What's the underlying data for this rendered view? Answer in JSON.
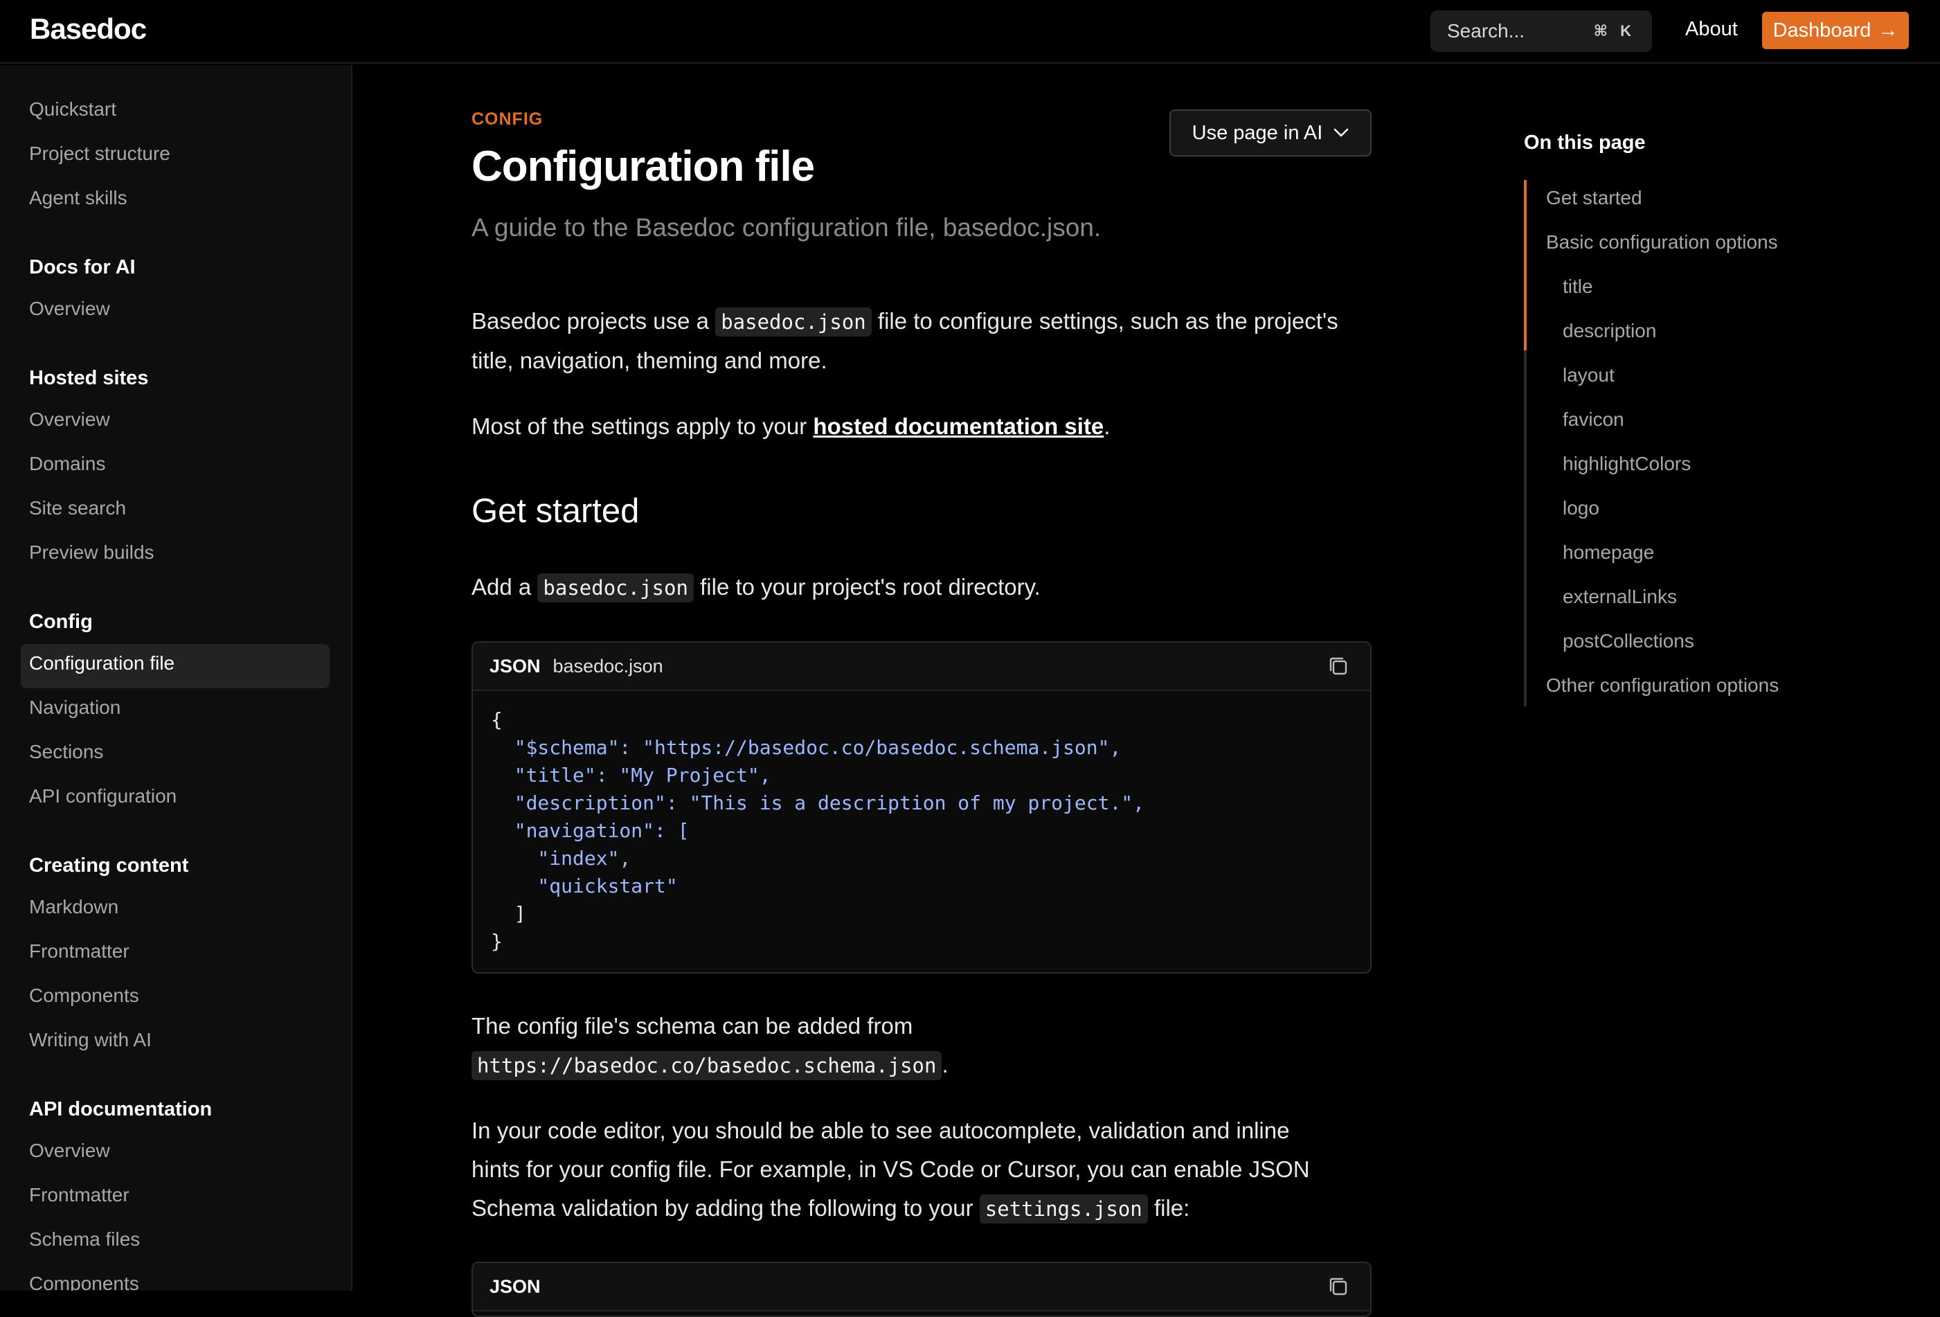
{
  "header": {
    "logo": "Basedoc",
    "search_placeholder": "Search...",
    "search_shortcut": "⌘ K",
    "about": "About",
    "dashboard": "Dashboard",
    "dashboard_arrow": "→"
  },
  "sidebar": {
    "top_items": [
      "Quickstart",
      "Project structure",
      "Agent skills"
    ],
    "sections": [
      {
        "heading": "Docs for AI",
        "items": [
          "Overview"
        ]
      },
      {
        "heading": "Hosted sites",
        "items": [
          "Overview",
          "Domains",
          "Site search",
          "Preview builds"
        ]
      },
      {
        "heading": "Config",
        "items": [
          "Configuration file",
          "Navigation",
          "Sections",
          "API configuration"
        ]
      },
      {
        "heading": "Creating content",
        "items": [
          "Markdown",
          "Frontmatter",
          "Components",
          "Writing with AI"
        ]
      },
      {
        "heading": "API documentation",
        "items": [
          "Overview",
          "Frontmatter",
          "Schema files",
          "Components"
        ]
      }
    ],
    "active_item": "Configuration file"
  },
  "main": {
    "eyebrow": "CONFIG",
    "title": "Configuration file",
    "subtitle": "A guide to the Basedoc configuration file, basedoc.json.",
    "use_ai_button": "Use page in AI",
    "p1_pre": "Basedoc projects use a ",
    "p1_code": "basedoc.json",
    "p1_post": " file to configure settings, such as the project's title, navigation, theming and more.",
    "p2_pre": "Most of the settings apply to your ",
    "p2_link": "hosted documentation site",
    "p2_post": ".",
    "h2_get_started": "Get started",
    "p3_pre": "Add a ",
    "p3_code": "basedoc.json",
    "p3_post": " file to your project's root directory.",
    "code1": {
      "lang": "JSON",
      "filename": "basedoc.json",
      "lines": [
        "{",
        "  \"$schema\": \"https://basedoc.co/basedoc.schema.json\",",
        "  \"title\": \"My Project\",",
        "  \"description\": \"This is a description of my project.\",",
        "  \"navigation\": [",
        "    \"index\",",
        "    \"quickstart\"",
        "  ]",
        "}"
      ]
    },
    "p4_pre": "The config file's schema can be added from ",
    "p4_code": "https://basedoc.co/basedoc.schema.json",
    "p4_post": ".",
    "p5_pre": "In your code editor, you should be able to see autocomplete, validation and inline hints for your config file. For example, in VS Code or Cursor, you can enable JSON Schema validation by adding the following to your ",
    "p5_code": "settings.json",
    "p5_post": " file:",
    "code2": {
      "lang": "JSON"
    }
  },
  "toc": {
    "title": "On this page",
    "items": [
      {
        "label": "Get started",
        "level": 1
      },
      {
        "label": "Basic configuration options",
        "level": 1
      },
      {
        "label": "title",
        "level": 2
      },
      {
        "label": "description",
        "level": 2
      },
      {
        "label": "layout",
        "level": 2
      },
      {
        "label": "favicon",
        "level": 2
      },
      {
        "label": "highlightColors",
        "level": 2
      },
      {
        "label": "logo",
        "level": 2
      },
      {
        "label": "homepage",
        "level": 2
      },
      {
        "label": "externalLinks",
        "level": 2
      },
      {
        "label": "postCollections",
        "level": 2
      },
      {
        "label": "Other configuration options",
        "level": 1
      }
    ]
  },
  "colors": {
    "accent": "#e26e24",
    "background": "#000000",
    "code_key": "#9ab8ff"
  }
}
